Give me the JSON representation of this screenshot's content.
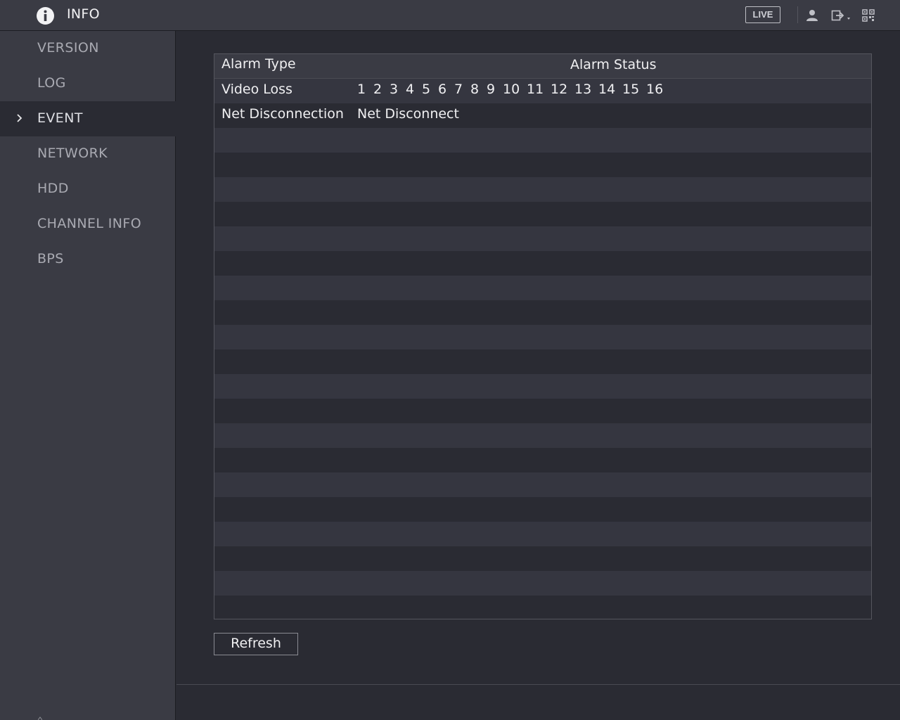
{
  "header": {
    "title": "INFO",
    "app_icon": "info-icon",
    "live_label": "LIVE",
    "icons": [
      "user-icon",
      "logout-icon",
      "qr-code-icon"
    ]
  },
  "sidebar": {
    "items": [
      {
        "label": "VERSION",
        "active": false
      },
      {
        "label": "LOG",
        "active": false
      },
      {
        "label": "EVENT",
        "active": true
      },
      {
        "label": "NETWORK",
        "active": false
      },
      {
        "label": "HDD",
        "active": false
      },
      {
        "label": "CHANNEL INFO",
        "active": false
      },
      {
        "label": "BPS",
        "active": false
      }
    ]
  },
  "table": {
    "headers": {
      "type": "Alarm Type",
      "status": "Alarm Status"
    },
    "rows": [
      {
        "type": "Video Loss",
        "channels": [
          "1",
          "2",
          "3",
          "4",
          "5",
          "6",
          "7",
          "8",
          "9",
          "10",
          "11",
          "12",
          "13",
          "14",
          "15",
          "16"
        ]
      },
      {
        "type": "Net Disconnection",
        "status": "Net Disconnect"
      }
    ]
  },
  "actions": {
    "refresh_label": "Refresh"
  },
  "colors": {
    "background": "#2a2b33",
    "panel": "#3a3b44",
    "row_alt": "#353640",
    "text": "#f0f0f2",
    "nav_text": "#a9aab2"
  }
}
